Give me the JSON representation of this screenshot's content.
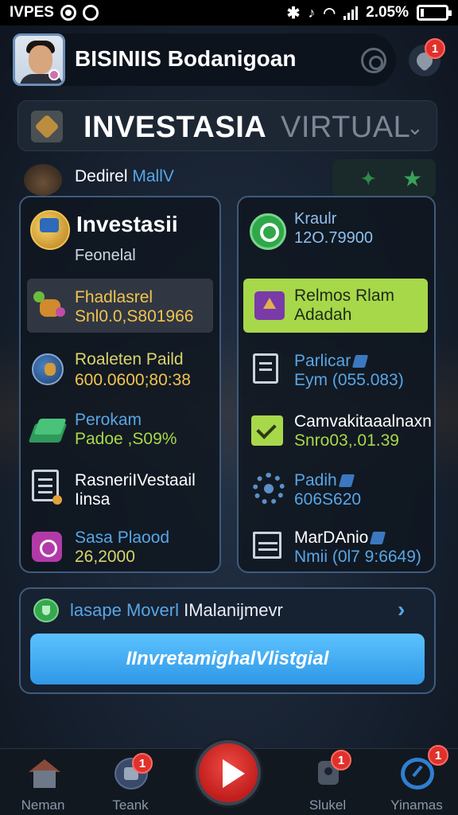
{
  "status_bar": {
    "carrier": "IVPES",
    "battery_percent": "2.05%",
    "battery_level": 0.1
  },
  "header": {
    "app_title": "BISINIIS Bodanigoan",
    "notification_count": "1"
  },
  "title_bar": {
    "title_main": "INVESTASIA",
    "title_secondary": "VIRTUAL"
  },
  "subrow": {
    "label_a": "Dedirel",
    "label_b": "MallV"
  },
  "left_panel": {
    "title": "Investasii",
    "subtitle": "Feonelal",
    "items": [
      {
        "label": "Fhadlasrel",
        "value": "Snl0.0,S801966",
        "label_color": "#f2c34f",
        "value_color": "#f2c34f",
        "icon": "animal-icon"
      },
      {
        "label": "Roaleten Paild",
        "value": "600.0600;80:38",
        "label_color": "#d8d46a",
        "value_color": "#f2c34f",
        "icon": "globe-icon"
      },
      {
        "label": "Perokam",
        "value": "Padoe ,S09%",
        "label_color": "#58a6e6",
        "value_color": "#a7d84a",
        "value_accent": "#e0653a",
        "icon": "cash-icon"
      },
      {
        "label": "RasneriIVestaail",
        "value": "Iinsa",
        "label_color": "#ffffff",
        "value_color": "#ffffff",
        "icon": "document-icon"
      },
      {
        "label": "Sasa Plaood",
        "value": "26,2000",
        "label_color": "#58a6e6",
        "value_color": "#d8d46a",
        "icon": "purple-box-icon"
      }
    ]
  },
  "right_panel": {
    "head_label": "Kraulr",
    "head_value": "12O.79900",
    "primary_button": {
      "line1": "Relmos Rlam",
      "line2": "Adadah"
    },
    "items": [
      {
        "label": "Parlicar",
        "value": "Eym (055.083)",
        "icon": "clipboard-icon"
      },
      {
        "label": "Camvakitaaalnaxn",
        "value": "Snro03,.01.39",
        "label_color": "#ffffff",
        "value_color": "#a7d84a",
        "icon": "check-icon"
      },
      {
        "label": "Padih",
        "value": "606S620",
        "icon": "gear-icon"
      },
      {
        "label": "MarDAnio",
        "value": "Nmii (0l7 9:6649)",
        "icon": "money-icon"
      }
    ]
  },
  "bottom_card": {
    "label_a": "lasape Moverl",
    "label_b": "IMalanijmevr",
    "cta_label": "IInvretamighalVlistgial"
  },
  "nav": {
    "items": [
      {
        "label": "Neman",
        "badge": ""
      },
      {
        "label": "Teank",
        "badge": "1"
      },
      {
        "label": "Slukel",
        "badge": "1"
      },
      {
        "label": "Yinamas",
        "badge": "1"
      }
    ]
  },
  "colors": {
    "accent_blue": "#58a6e6",
    "accent_green": "#a7d84a",
    "accent_gold": "#f2c34f",
    "badge_red": "#e0312c",
    "panel_border": "#3f5b7c"
  }
}
